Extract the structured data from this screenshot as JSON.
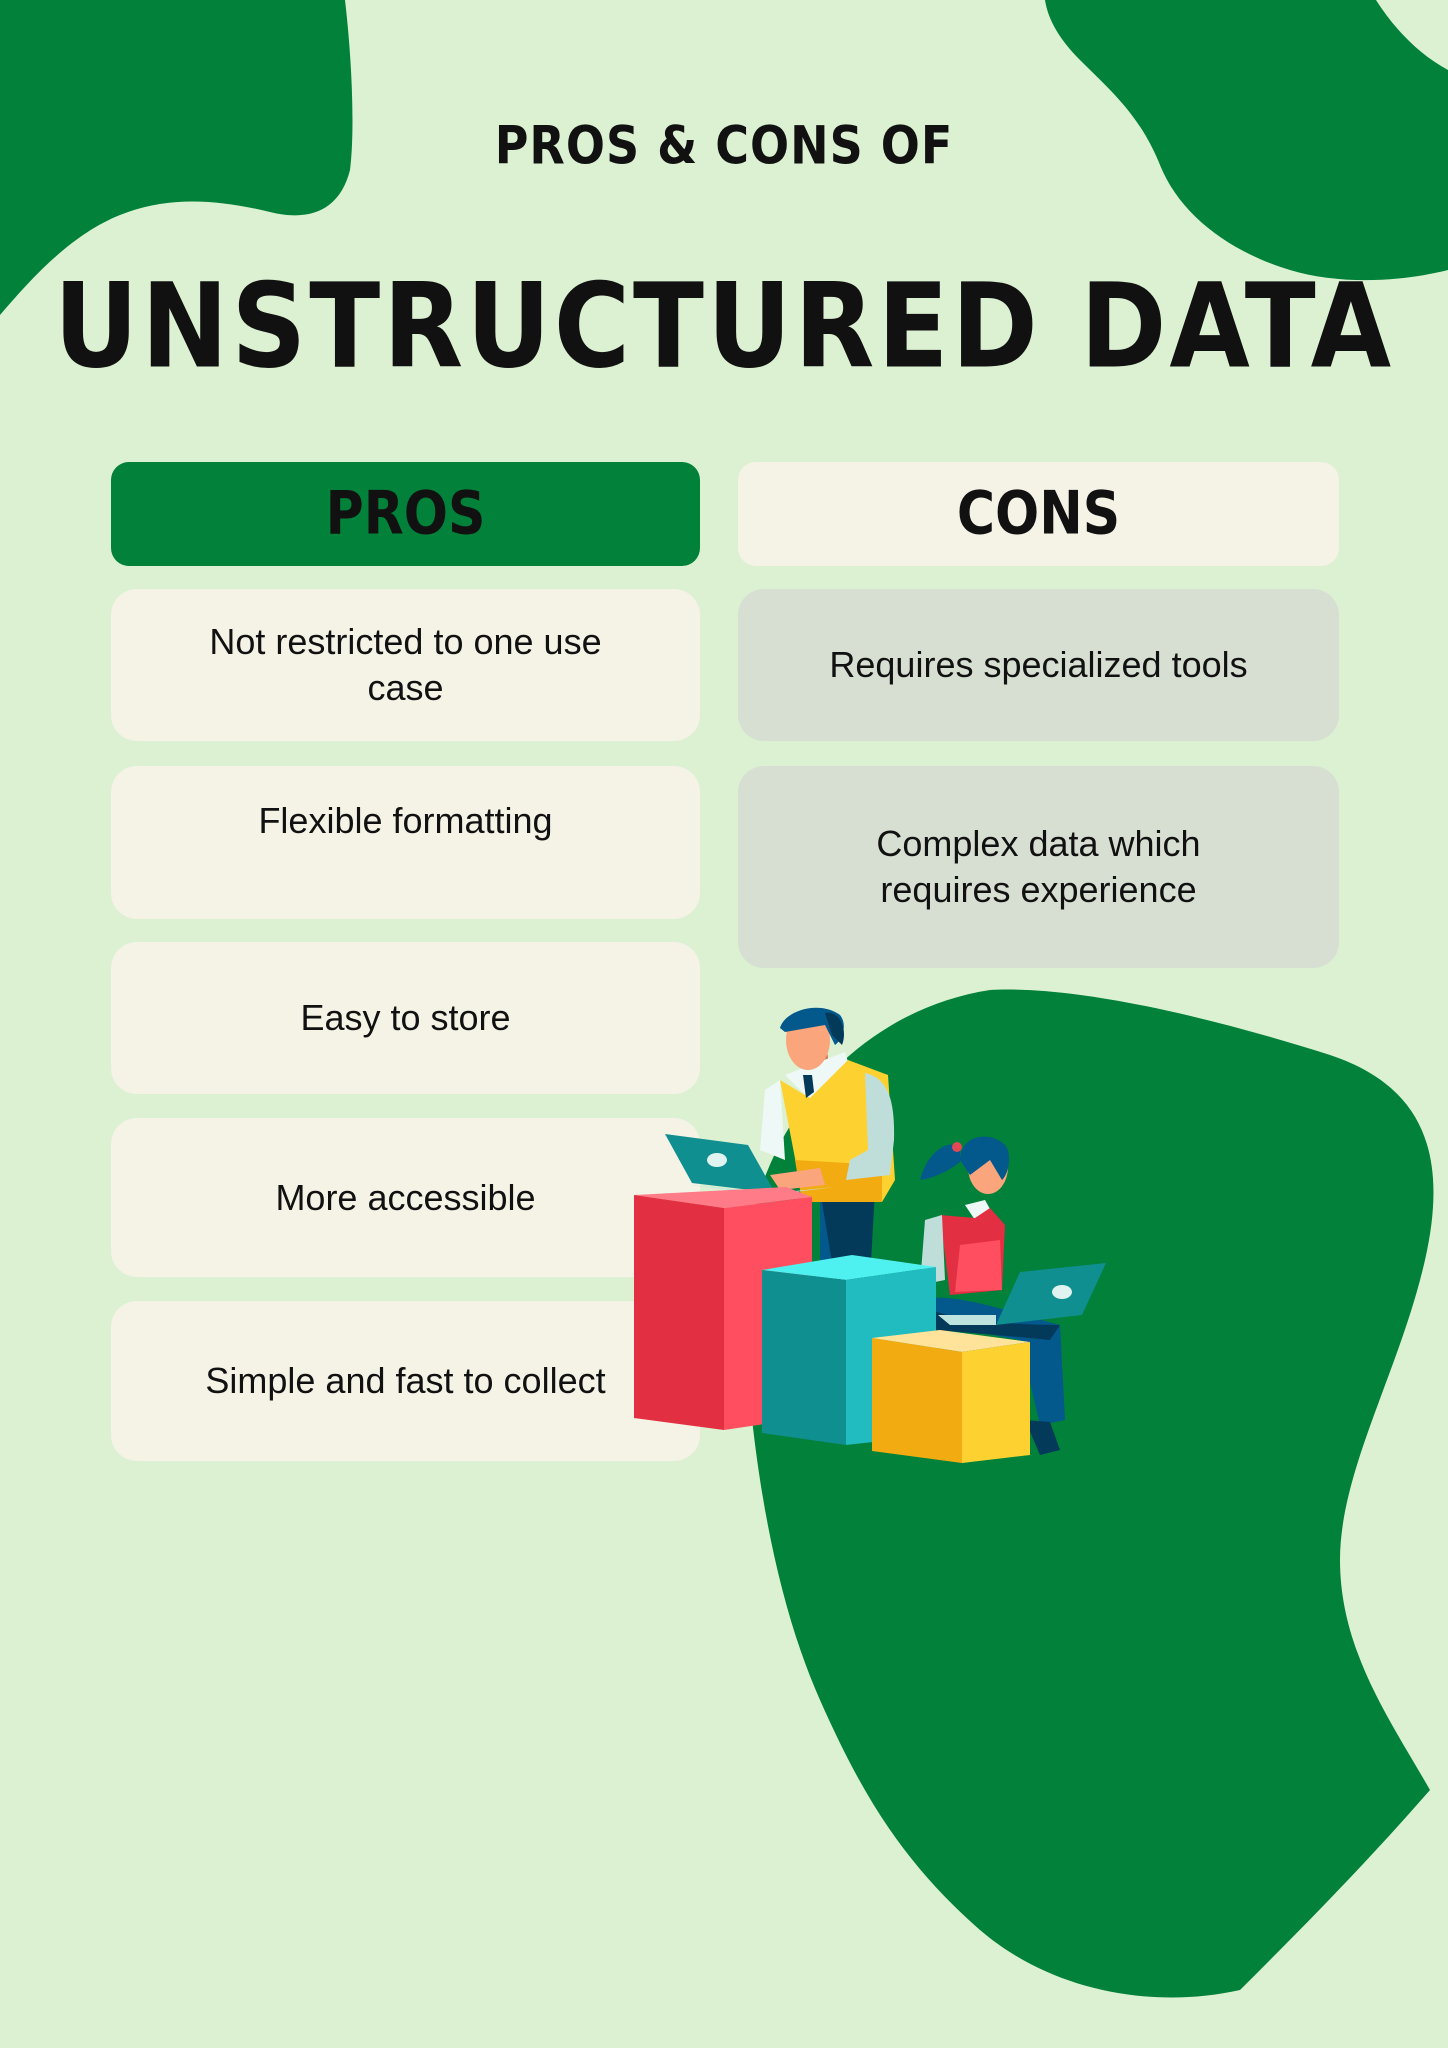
{
  "header": {
    "subtitle": "PROS & CONS OF",
    "title": "UNSTRUCTURED DATA"
  },
  "pros": {
    "heading": "PROS",
    "items": [
      "Not restricted to one use case",
      "Flexible formatting",
      "Easy to store",
      "More accessible",
      "Simple and fast to collect"
    ]
  },
  "cons": {
    "heading": "CONS",
    "items": [
      "Requires specialized tools",
      "Complex data which requires experience"
    ]
  },
  "colors": {
    "background": "#dcf1d2",
    "accent_green": "#018139",
    "card_light": "#f5f2e6",
    "card_gray": "#d6dfd2"
  }
}
